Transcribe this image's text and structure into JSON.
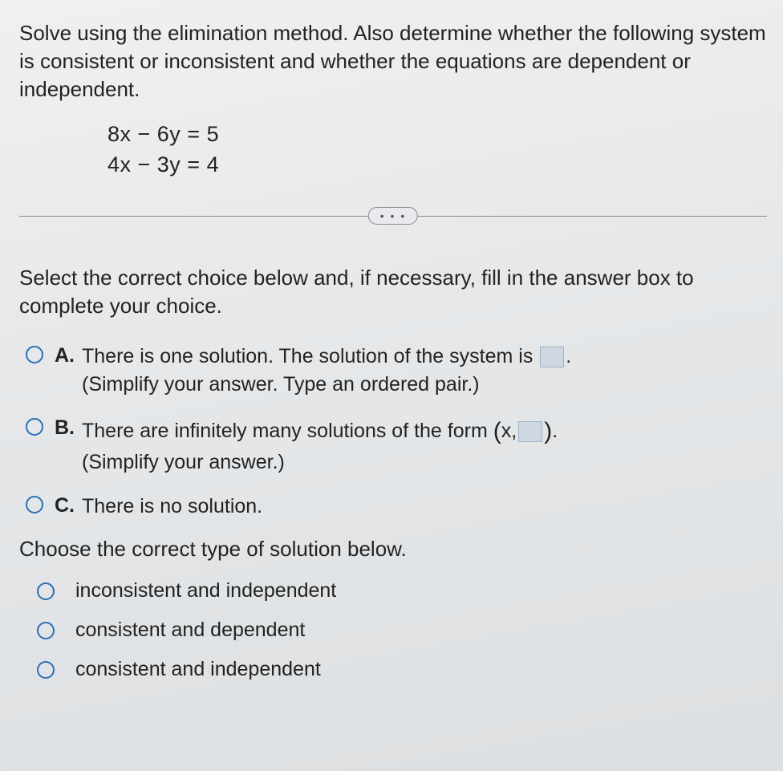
{
  "question": {
    "prompt": "Solve using the elimination method. Also determine whether the following system is consistent or inconsistent and whether the equations are dependent or independent.",
    "equation1": "8x − 6y = 5",
    "equation2": "4x − 3y = 4"
  },
  "divider_dots": "• • •",
  "instructions": "Select the correct choice below and, if necessary, fill in the answer box to complete your choice.",
  "choices": {
    "a": {
      "letter": "A.",
      "text_before": "There is one solution. The solution of the system is ",
      "text_after": ".",
      "hint": "(Simplify your answer. Type an ordered pair.)"
    },
    "b": {
      "letter": "B.",
      "text_before": "There are infinitely many solutions of the form ",
      "paren_open": "(",
      "inner_prefix": "x,",
      "paren_close": ")",
      "text_after": ".",
      "hint": "(Simplify your answer.)"
    },
    "c": {
      "letter": "C.",
      "text": "There is no solution."
    }
  },
  "type_prompt": "Choose the correct type of solution below.",
  "types": {
    "t1": "inconsistent and independent",
    "t2": "consistent and dependent",
    "t3": "consistent and independent"
  }
}
